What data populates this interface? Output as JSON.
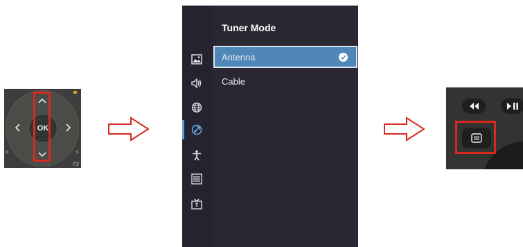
{
  "remote_left": {
    "ok_label": "OK",
    "corner_labels": {
      "left": "o",
      "right": "s",
      "bottom_right": "ГУ"
    },
    "highlight_color": "#d9281f"
  },
  "menu": {
    "title": "Tuner Mode",
    "items": [
      {
        "label": "Antenna",
        "selected": true
      },
      {
        "label": "Cable",
        "selected": false
      }
    ],
    "sidebar_icons": [
      "picture-icon",
      "sound-icon",
      "network-icon",
      "channel-icon",
      "accessibility-icon",
      "list-icon",
      "tv-icon"
    ],
    "active_sidebar_index": 3,
    "colors": {
      "panel": "#2a2733",
      "selected": "#4f87b8",
      "accent": "#5aa0d6"
    }
  },
  "remote_right": {
    "buttons": [
      "rewind-icon",
      "play-pause-icon",
      "menu-icon"
    ],
    "highlight_color": "#d9281f"
  }
}
